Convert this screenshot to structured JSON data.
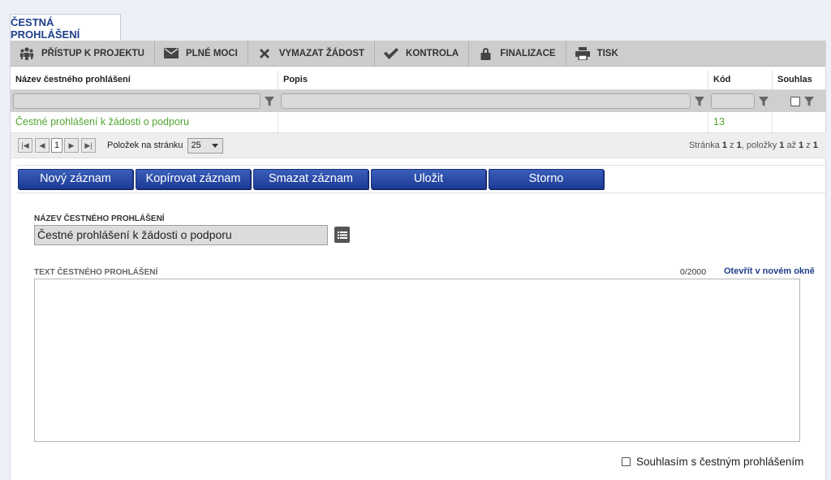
{
  "tab": {
    "label": "ČESTNÁ PROHLÁŠENÍ"
  },
  "toolbar": {
    "items": [
      {
        "label": "PŘÍSTUP K PROJEKTU",
        "icon": "people-icon"
      },
      {
        "label": "PLNÉ MOCI",
        "icon": "envelope-icon"
      },
      {
        "label": "VYMAZAT ŽÁDOST",
        "icon": "x-icon"
      },
      {
        "label": "KONTROLA",
        "icon": "check-icon"
      },
      {
        "label": "FINALIZACE",
        "icon": "lock-icon"
      },
      {
        "label": "TISK",
        "icon": "printer-icon"
      }
    ]
  },
  "grid": {
    "columns": [
      "Název čestného prohlášení",
      "Popis",
      "Kód",
      "Souhlas"
    ],
    "rows": [
      {
        "nazev": "Čestné prohlášení k žádosti o podporu",
        "popis": "",
        "kod": "13",
        "souhlas": ""
      }
    ]
  },
  "pager": {
    "current_page": "1",
    "per_page_label": "Položek na stránku",
    "per_page_value": "25",
    "info_prefix": "Stránka ",
    "info_page": "1",
    "info_mid1": " z ",
    "info_pages": "1",
    "info_mid2": ", položky ",
    "info_from": "1",
    "info_mid3": " až ",
    "info_to": "1",
    "info_mid4": " z ",
    "info_total": "1"
  },
  "actions": {
    "new": "Nový záznam",
    "copy": "Kopírovat záznam",
    "delete": "Smazat záznam",
    "save": "Uložit",
    "cancel": "Storno"
  },
  "form": {
    "name_label": "NÁZEV ČESTNÉHO PROHLÁŠENÍ",
    "name_value": "Čestné prohlášení k žádosti o podporu",
    "text_label": "TEXT ČESTNÉHO PROHLÁŠENÍ",
    "text_value": "",
    "counter": "0/2000",
    "open_link": "Otevřít v novém okně",
    "agree_label": "Souhlasím s čestným prohlášením"
  },
  "colors": {
    "accent": "#1f3f8c",
    "button": "#2a4aa8",
    "link_green": "#53a532"
  }
}
